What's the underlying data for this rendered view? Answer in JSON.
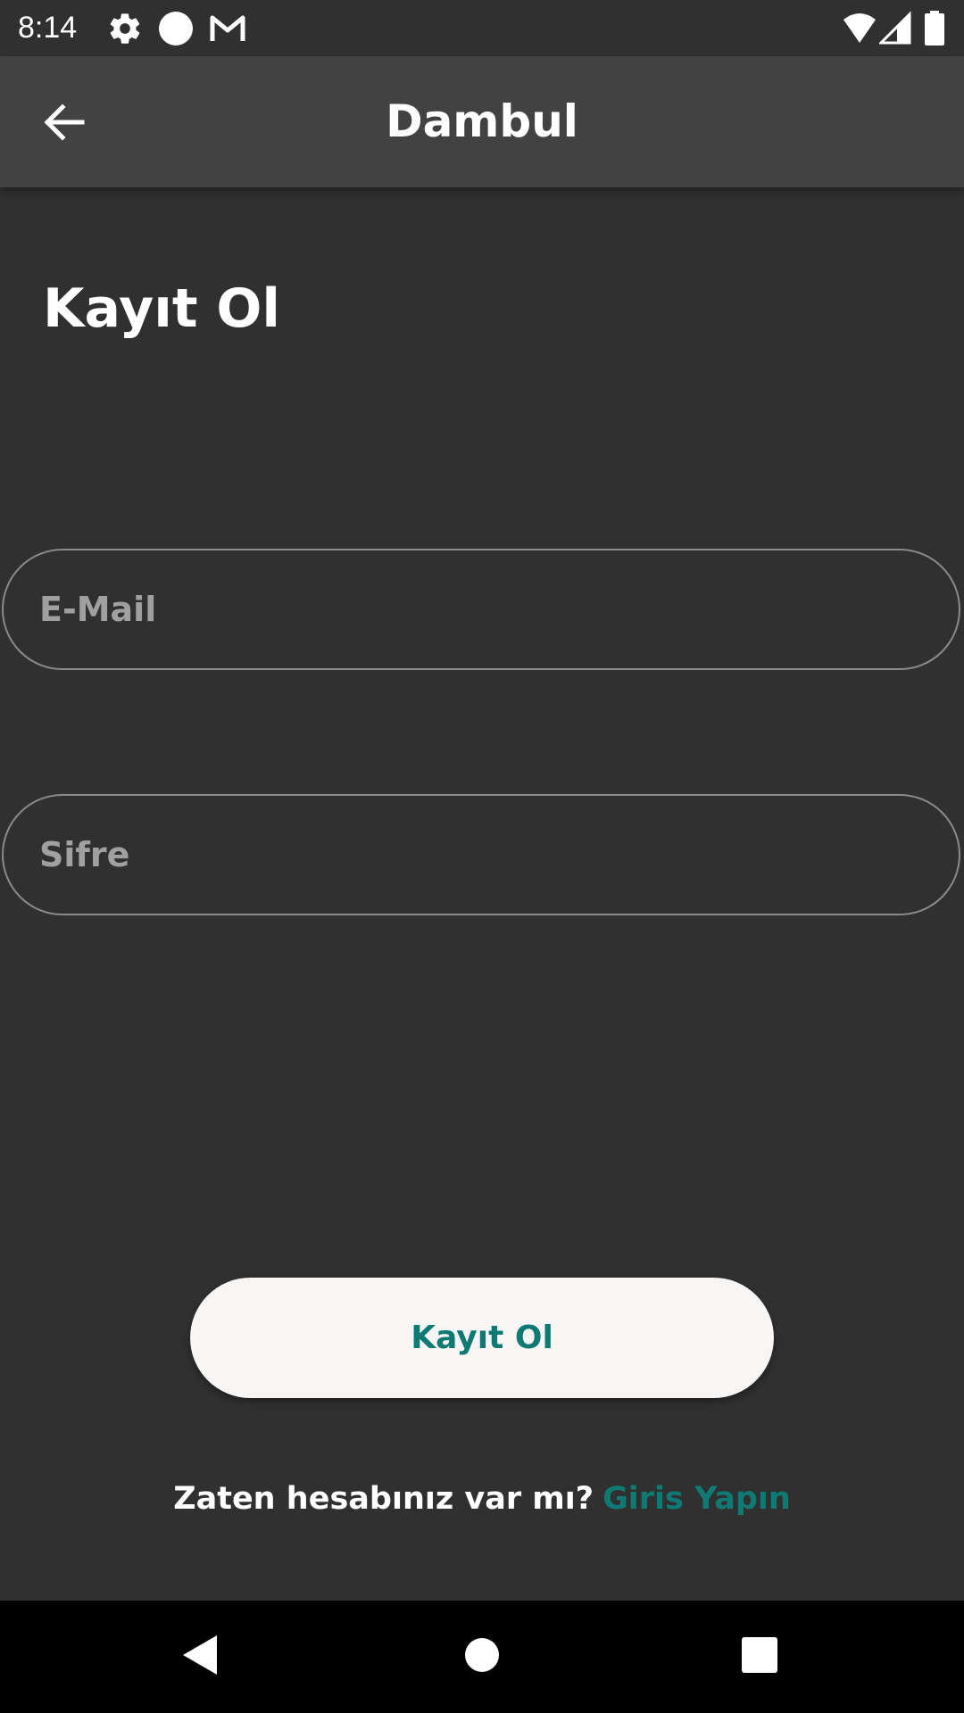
{
  "status_bar": {
    "time": "8:14",
    "left_icons": [
      "gear-icon",
      "circle-icon",
      "gmail-icon"
    ],
    "right_icons": [
      "wifi-icon",
      "signal-icon",
      "battery-icon"
    ]
  },
  "app_bar": {
    "title": "Dambul",
    "back_icon": "arrow-left-icon"
  },
  "page": {
    "heading": "Kayıt Ol"
  },
  "form": {
    "email_placeholder": "E-Mail",
    "email_value": "",
    "password_placeholder": "Sifre",
    "password_value": "",
    "submit_label": "Kayıt Ol"
  },
  "signin": {
    "prompt": "Zaten hesabınız var mı?",
    "link": "Giris Yapın"
  },
  "colors": {
    "background": "#303030",
    "app_bar": "#424242",
    "accent": "#0f7a73",
    "button_bg": "#f8f5f5"
  },
  "nav_bar": {
    "icons": [
      "back-triangle-icon",
      "home-circle-icon",
      "recents-square-icon"
    ]
  }
}
